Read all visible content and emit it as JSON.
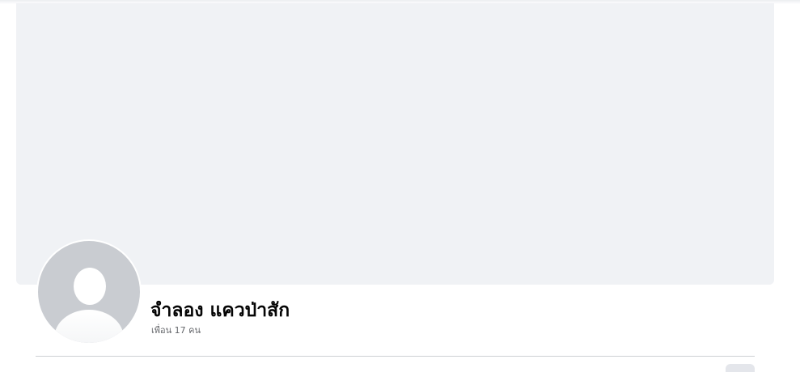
{
  "profile": {
    "name": "จำลอง แควป่าสัก",
    "friends_text": "เพื่อน 17 คน"
  },
  "icons": {
    "avatar": "default-avatar-icon"
  },
  "colors": {
    "cover_background": "#f0f2f5",
    "avatar_background": "#c9ccd1",
    "name_text": "#050505",
    "secondary_text": "#65676b",
    "divider": "#ced0d4"
  }
}
